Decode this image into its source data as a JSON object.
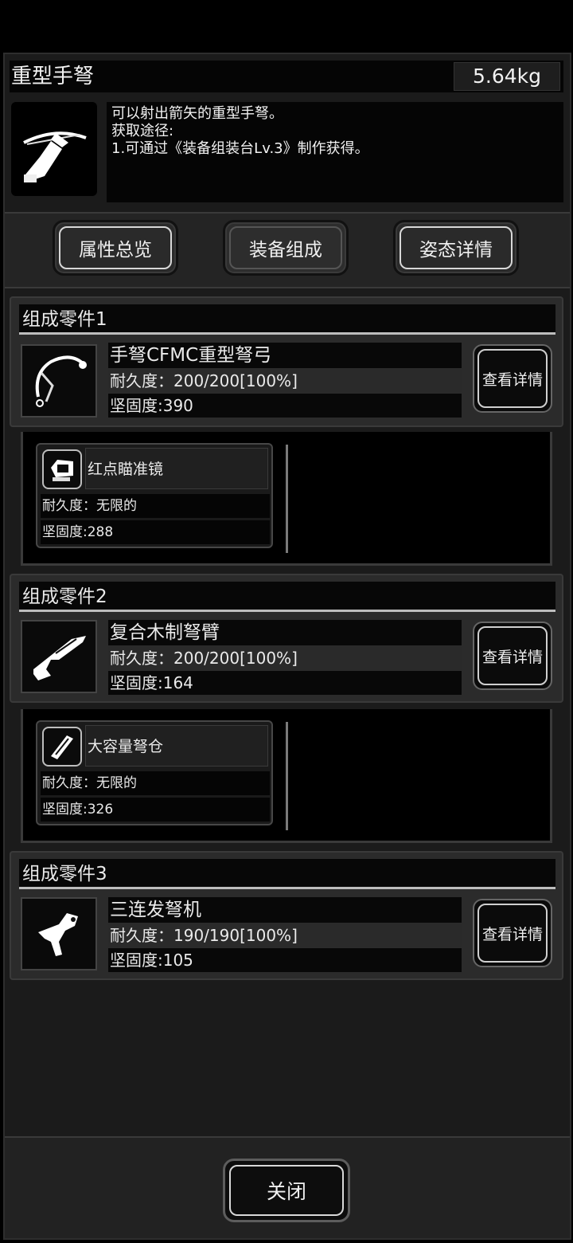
{
  "item": {
    "name": "重型手弩",
    "weight": "5.64kg",
    "icon": "crossbow-icon",
    "description": [
      "可以射出箭矢的重型手弩。",
      "获取途径:",
      "1.可通过《装备组装台Lv.3》制作获得。"
    ]
  },
  "tabs": [
    {
      "label": "属性总览",
      "active": false
    },
    {
      "label": "装备组成",
      "active": true
    },
    {
      "label": "姿态详情",
      "active": false
    }
  ],
  "parts": [
    {
      "title": "组成零件1",
      "name": "手弩CFMC重型弩弓",
      "durability": "耐久度：200/200[100%]",
      "firmness": "坚固度:390",
      "icon": "crossbow-bow-icon",
      "detail_label": "查看详情",
      "sub": {
        "name": "红点瞄准镜",
        "icon": "red-dot-sight-icon",
        "durability": "耐久度：无限的",
        "firmness": "坚固度:288"
      }
    },
    {
      "title": "组成零件2",
      "name": "复合木制弩臂",
      "durability": "耐久度：200/200[100%]",
      "firmness": "坚固度:164",
      "icon": "crossbow-stock-icon",
      "detail_label": "查看详情",
      "sub": {
        "name": "大容量弩仓",
        "icon": "magazine-icon",
        "durability": "耐久度：无限的",
        "firmness": "坚固度:326"
      }
    },
    {
      "title": "组成零件3",
      "name": "三连发弩机",
      "durability": "耐久度：190/190[100%]",
      "firmness": "坚固度:105",
      "icon": "trigger-mechanism-icon",
      "detail_label": "查看详情"
    }
  ],
  "close_label": "关闭"
}
